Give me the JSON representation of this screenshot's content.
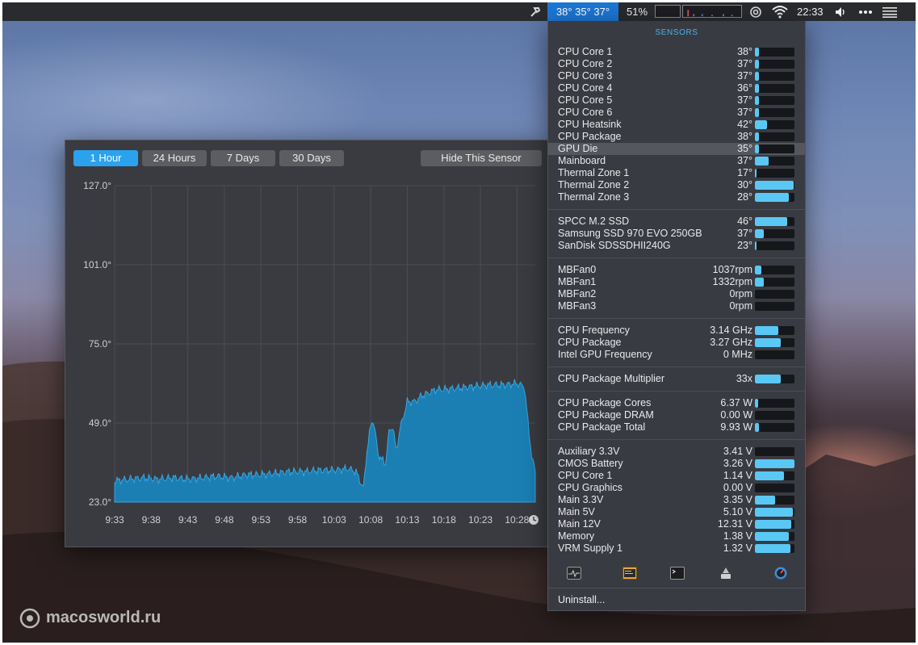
{
  "menubar": {
    "temps": "38° 35° 37°",
    "battery": "51%",
    "time": "22:33",
    "icons": [
      "hammer-icon",
      "cpu-graph-icon",
      "network-graph-icon",
      "airdrop-icon",
      "wifi-icon",
      "volume-icon",
      "more-icon",
      "list-icon"
    ]
  },
  "chart_window": {
    "buttons": [
      "1 Hour",
      "24 Hours",
      "7 Days",
      "30 Days"
    ],
    "active_button": "1 Hour",
    "hide_button": "Hide This Sensor",
    "clock_icon": "clock-icon"
  },
  "chart_data": {
    "type": "area",
    "title": "",
    "xlabel": "",
    "ylabel": "",
    "ylim": [
      23.0,
      127.0
    ],
    "y_ticks": [
      "127.0°",
      "101.0°",
      "75.0°",
      "49.0°",
      "23.0°"
    ],
    "x_ticks": [
      "9:33",
      "9:38",
      "9:43",
      "9:48",
      "9:53",
      "9:58",
      "10:03",
      "10:08",
      "10:13",
      "10:18",
      "10:23",
      "10:28"
    ],
    "color": "#1b7fb3",
    "series": [
      {
        "name": "",
        "points": [
          [
            "9:33",
            30
          ],
          [
            "9:35",
            30.5
          ],
          [
            "9:37",
            31
          ],
          [
            "9:39",
            30.5
          ],
          [
            "9:41",
            31
          ],
          [
            "9:43",
            30.5
          ],
          [
            "9:45",
            31
          ],
          [
            "9:47",
            31.5
          ],
          [
            "9:49",
            31
          ],
          [
            "9:51",
            32
          ],
          [
            "9:53",
            32
          ],
          [
            "9:55",
            32.5
          ],
          [
            "9:57",
            33
          ],
          [
            "9:59",
            33
          ],
          [
            "10:01",
            33.5
          ],
          [
            "10:03",
            33.5
          ],
          [
            "10:05",
            34
          ],
          [
            "10:06",
            33
          ],
          [
            "10:07",
            27.5
          ],
          [
            "10:07:30",
            40
          ],
          [
            "10:08",
            48
          ],
          [
            "10:08:20",
            50
          ],
          [
            "10:08:40",
            45
          ],
          [
            "10:09",
            39
          ],
          [
            "10:09:30",
            37
          ],
          [
            "10:10",
            35.5
          ],
          [
            "10:10:30",
            46
          ],
          [
            "10:11",
            48
          ],
          [
            "10:11:30",
            40
          ],
          [
            "10:12",
            47
          ],
          [
            "10:13",
            56
          ],
          [
            "10:14",
            56
          ],
          [
            "10:15",
            58
          ],
          [
            "10:16",
            59
          ],
          [
            "10:17",
            60
          ],
          [
            "10:18",
            60
          ],
          [
            "10:20",
            60.5
          ],
          [
            "10:22",
            61
          ],
          [
            "10:24",
            61.5
          ],
          [
            "10:26",
            61.5
          ],
          [
            "10:28",
            62
          ],
          [
            "10:29",
            61
          ],
          [
            "10:30",
            38
          ],
          [
            "10:30:30",
            33
          ]
        ]
      }
    ]
  },
  "panel": {
    "title": "SENSORS",
    "groups": [
      [
        {
          "name": "CPU Core 1",
          "value": "38°",
          "fill": 0.11
        },
        {
          "name": "CPU Core 2",
          "value": "37°",
          "fill": 0.11
        },
        {
          "name": "CPU Core 3",
          "value": "37°",
          "fill": 0.11
        },
        {
          "name": "CPU Core 4",
          "value": "36°",
          "fill": 0.1
        },
        {
          "name": "CPU Core 5",
          "value": "37°",
          "fill": 0.11
        },
        {
          "name": "CPU Core 6",
          "value": "37°",
          "fill": 0.11
        },
        {
          "name": "CPU Heatsink",
          "value": "42°",
          "fill": 0.3
        },
        {
          "name": "CPU Package",
          "value": "38°",
          "fill": 0.11
        },
        {
          "name": "GPU Die",
          "value": "35°",
          "fill": 0.1,
          "highlight": true
        },
        {
          "name": "Mainboard",
          "value": "37°",
          "fill": 0.35
        },
        {
          "name": "Thermal Zone 1",
          "value": "17°",
          "fill": 0.05
        },
        {
          "name": "Thermal Zone 2",
          "value": "30°",
          "fill": 0.98
        },
        {
          "name": "Thermal Zone 3",
          "value": "28°",
          "fill": 0.86
        }
      ],
      [
        {
          "name": "SPCC M.2 SSD",
          "value": "46°",
          "fill": 0.82
        },
        {
          "name": "Samsung SSD 970 EVO 250GB",
          "value": "37°",
          "fill": 0.22
        },
        {
          "name": "SanDisk SDSSDHII240G",
          "value": "23°",
          "fill": 0.04
        }
      ],
      [
        {
          "name": "MBFan0",
          "value": "1037rpm",
          "fill": 0.16
        },
        {
          "name": "MBFan1",
          "value": "1332rpm",
          "fill": 0.22
        },
        {
          "name": "MBFan2",
          "value": "0rpm",
          "fill": 0
        },
        {
          "name": "MBFan3",
          "value": "0rpm",
          "fill": 0
        }
      ],
      [
        {
          "name": "CPU Frequency",
          "value": "3.14 GHz",
          "fill": 0.6
        },
        {
          "name": "CPU Package",
          "value": "3.27 GHz",
          "fill": 0.65
        },
        {
          "name": "Intel GPU Frequency",
          "value": "0 MHz",
          "fill": 0
        }
      ],
      [
        {
          "name": "CPU Package Multiplier",
          "value": "33x",
          "fill": 0.65
        }
      ],
      [
        {
          "name": "CPU Package Cores",
          "value": "6.37 W",
          "fill": 0.08
        },
        {
          "name": "CPU Package DRAM",
          "value": "0.00 W",
          "fill": 0
        },
        {
          "name": "CPU Package Total",
          "value": "9.93 W",
          "fill": 0.1
        }
      ],
      [
        {
          "name": "Auxiliary 3.3V",
          "value": "3.41 V",
          "fill": 0
        },
        {
          "name": "CMOS Battery",
          "value": "3.26 V",
          "fill": 1.0
        },
        {
          "name": "CPU Core 1",
          "value": "1.14 V",
          "fill": 0.74
        },
        {
          "name": "CPU Graphics",
          "value": "0.00 V",
          "fill": 0
        },
        {
          "name": "Main 3.3V",
          "value": "3.35 V",
          "fill": 0.5
        },
        {
          "name": "Main 5V",
          "value": "5.10 V",
          "fill": 0.95
        },
        {
          "name": "Main 12V",
          "value": "12.31 V",
          "fill": 0.92
        },
        {
          "name": "Memory",
          "value": "1.38 V",
          "fill": 0.86
        },
        {
          "name": "VRM Supply 1",
          "value": "1.32 V",
          "fill": 0.9
        }
      ]
    ],
    "footer_icons": [
      "activity-monitor-icon",
      "console-icon",
      "terminal-icon",
      "disk-utility-icon",
      "istat-icon"
    ],
    "uninstall": "Uninstall..."
  },
  "watermark": "macosworld.ru"
}
